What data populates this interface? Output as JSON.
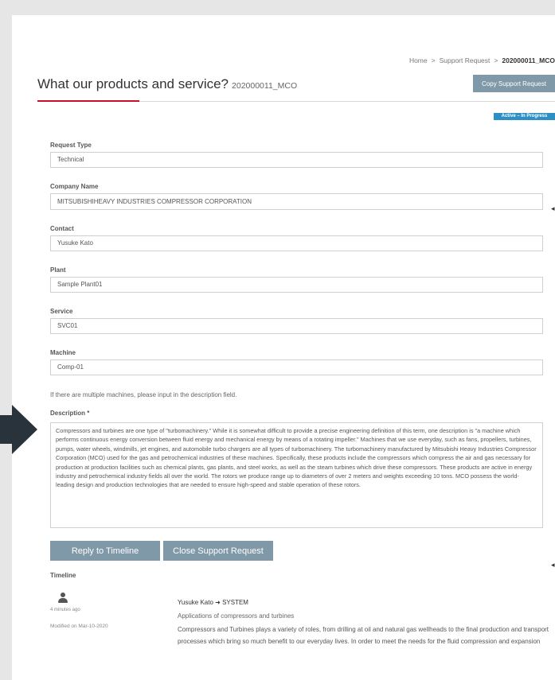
{
  "breadcrumb": {
    "items": [
      "Home",
      "Support Request"
    ],
    "separator": ">",
    "current": "202000011_MCO"
  },
  "page": {
    "title": "What our products and service?",
    "request_code": "202000011_MCO"
  },
  "copy_button_label": "Copy Support Request",
  "status_badge": "Active – In Progress",
  "form": {
    "request_type": {
      "label": "Request Type",
      "value": "Technical"
    },
    "company_name": {
      "label": "Company Name",
      "value": "MITSUBISHIHEAVY INDUSTRIES COMPRESSOR CORPORATION"
    },
    "contact": {
      "label": "Contact",
      "value": "Yusuke Kato"
    },
    "plant": {
      "label": "Plant",
      "value": "Sample Plant01"
    },
    "service": {
      "label": "Service",
      "value": "SVC01"
    },
    "machine": {
      "label": "Machine",
      "value": "Comp-01"
    },
    "hint": "If there are multiple machines, please input in the description field.",
    "description_label": "Description *",
    "description": "Compressors and turbines are one type of \"turbomachinery.\" While it is somewhat difficult to provide a precise engineering definition of this term, one description is \"a machine which performs continuous energy conversion between fluid energy and mechanical energy by means of a rotating impeller.\" Machines that we use everyday, such as fans, propellers, turbines, pumps, water wheels, windmills, jet engines, and automobile turbo chargers are all types of turbomachinery. The turbomachinery manufactured by Mitsubishi Heavy Industries Compressor Corporation (MCO) used for the gas and petrochemical industries of these machines. Specifically, these products include the compressors which compress the air and gas necessary for production at production facilities such as chemical plants, gas plants, and steel works, as well as the steam turbines which drive these compressors. These products are active in energy industry and petrochemical industry fields all over the world. The rotors we produce range up to diameters of over 2 meters and weights exceeding 10 tons. MCO possess the world-leading design and production technologies that are needed to ensure high-speed and stable operation of these rotors."
  },
  "actions": {
    "reply_label": "Reply to Timeline",
    "close_label": "Close Support Request"
  },
  "timeline": {
    "label": "Timeline",
    "entries": [
      {
        "time_ago": "4 minutes ago",
        "modified": "Modified on Mar-10-2020",
        "author": "Yusuke Kato ➜ SYSTEM",
        "subject": "Applications of compressors and turbines",
        "body": "Compressors and Turbines plays a variety of roles, from drilling at oil and natural gas wellheads to the final production and transport processes which bring so much benefit to our everyday lives. In order to meet the needs for the fluid compression and expansion that is required by these processes, MCO offers turbines that deliver high performance"
      }
    ]
  },
  "icons": {
    "avatar": "user-icon",
    "pointer_arrow": "arrow-right-icon",
    "side_marker": "arrow-left-icon"
  },
  "colors": {
    "accent_red": "#c8102e",
    "button_gray_blue": "#7f99a8",
    "badge_blue": "#2e8fc4",
    "arrow_dark": "#28333b"
  }
}
